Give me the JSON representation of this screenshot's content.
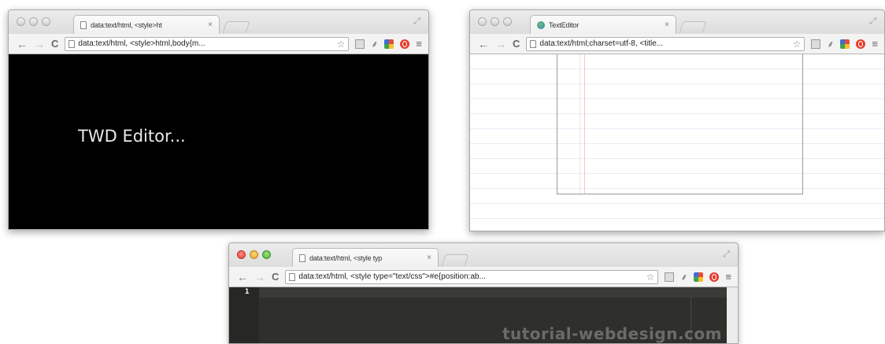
{
  "windows": [
    {
      "tab_title": "data:text/html, <style>ht",
      "tab_close": "×",
      "address": "data:text/html, <style>html,body{m...",
      "page_title_text": "TWD Editor..."
    },
    {
      "tab_title": "TextEditor",
      "tab_close": "×",
      "address": "data:text/html;charset=utf-8, <title..."
    },
    {
      "tab_title": "data:text/html, <style typ",
      "tab_close": "×",
      "address": "data:text/html, <style type=\"text/css\">#e{position:ab...",
      "line_number": "1",
      "watermark": "tutorial-webdesign.com"
    }
  ],
  "toolbar": {
    "back": "←",
    "forward": "→",
    "reload": "C",
    "star": "☆",
    "ext_b": "⸙",
    "menu": "≡",
    "fullscreen": "⤢"
  },
  "colors": {
    "editor_bg": "#2f2f2c",
    "black_page": "#000000",
    "traffic_red": "#e0443a",
    "traffic_yellow": "#e3a82a",
    "traffic_green": "#52b33a"
  }
}
